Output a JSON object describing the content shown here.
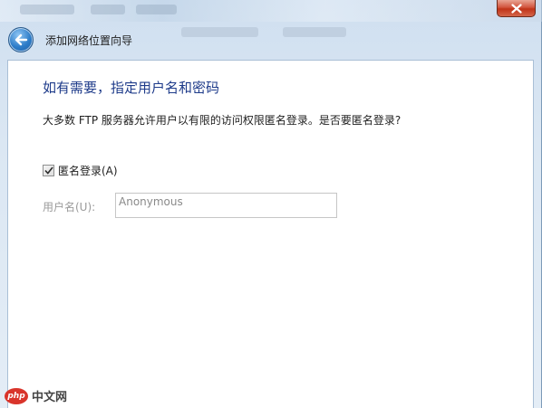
{
  "window": {
    "title": "添加网络位置向导"
  },
  "page": {
    "heading": "如有需要，指定用户名和密码",
    "description": "大多数 FTP 服务器允许用户以有限的访问权限匿名登录。是否要匿名登录?"
  },
  "anonymous_login": {
    "label": "匿名登录(A)",
    "checked": true
  },
  "username": {
    "label": "用户名(U):",
    "value": "Anonymous"
  },
  "watermark": {
    "logo_text": "php",
    "text": "中文网"
  }
}
